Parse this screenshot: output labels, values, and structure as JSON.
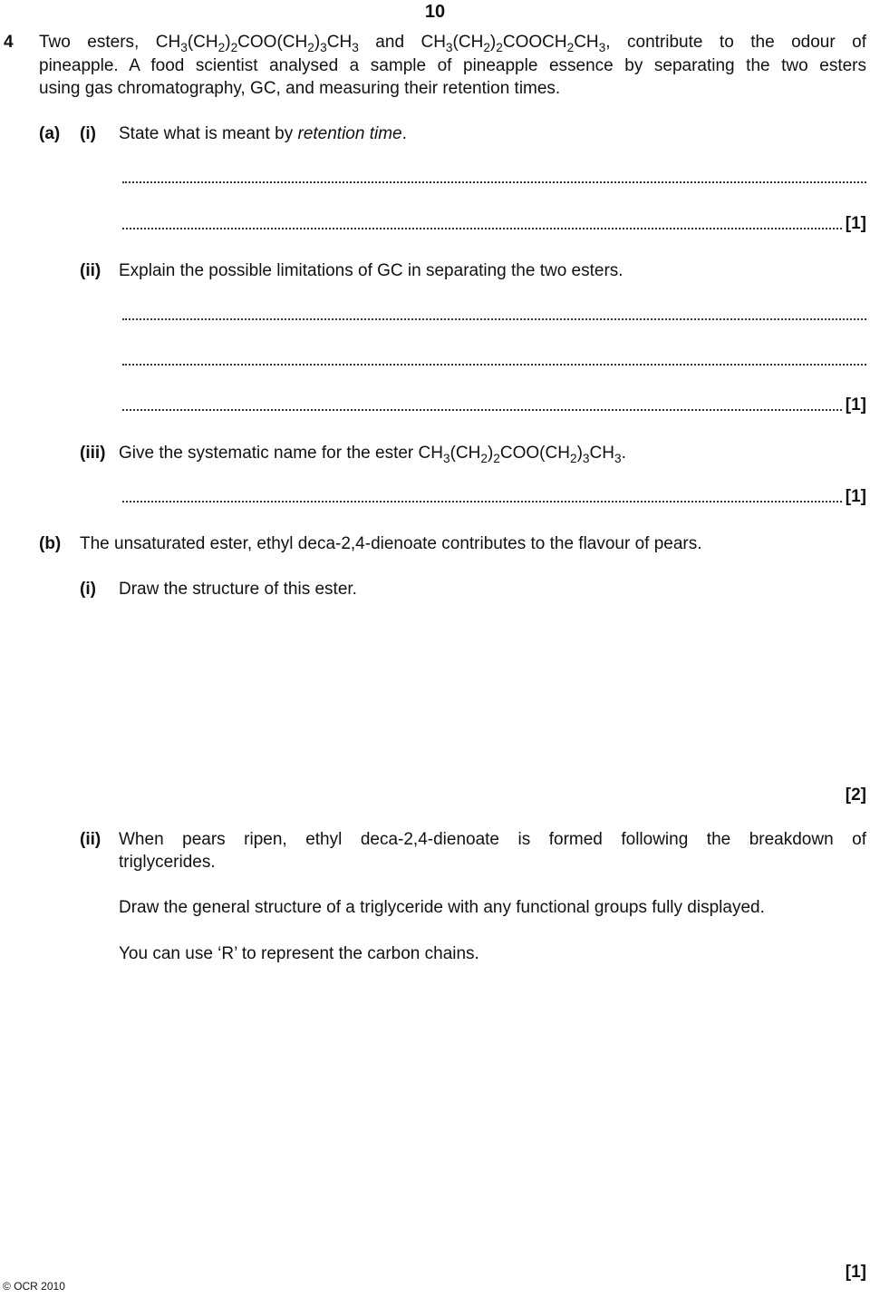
{
  "page_number": "10",
  "question": {
    "number": "4",
    "intro": {
      "line1": {
        "t1": "Two esters, CH",
        "s1": "3",
        "t2": "(CH",
        "s2": "2",
        "t3": ")",
        "s3": "2",
        "t4": "COO(CH",
        "s4": "2",
        "t5": ")",
        "s5": "3",
        "t6": "CH",
        "s6": "3",
        "t7": " and CH",
        "s7": "3",
        "t8": "(CH",
        "s8": "2",
        "t9": ")",
        "s9": "2",
        "t10": "COOCH",
        "s10": "2",
        "t11": "CH",
        "s11": "3",
        "t12": ", contribute to the odour of"
      },
      "line2": "pineapple. A food scientist analysed a sample of pineapple essence by separating the two esters",
      "line3": "using gas chromatography, GC, and measuring their retention times."
    },
    "part_a": {
      "label": "(a)",
      "i": {
        "label": "(i)",
        "text": "State what is meant by ",
        "italic": "retention time",
        "end": ".",
        "mark": "[1]"
      },
      "ii": {
        "label": "(ii)",
        "text": "Explain the possible limitations of GC in separating the two esters.",
        "mark": "[1]"
      },
      "iii": {
        "label": "(iii)",
        "t1": "Give the systematic name for the ester CH",
        "s1": "3",
        "t2": "(CH",
        "s2": "2",
        "t3": ")",
        "s3": "2",
        "t4": "COO(CH",
        "s4": "2",
        "t5": ")",
        "s5": "3",
        "t6": "CH",
        "s6": "3",
        "t7": ".",
        "mark": "[1]"
      }
    },
    "part_b": {
      "label": "(b)",
      "text": "The unsaturated ester, ethyl deca-2,4-dienoate contributes to the flavour of pears.",
      "i": {
        "label": "(i)",
        "text": "Draw the structure of this ester.",
        "mark": "[2]"
      },
      "ii": {
        "label": "(ii)",
        "line1": "When pears ripen, ethyl deca-2,4-dienoate is formed following the breakdown of",
        "line2": "triglycerides.",
        "instruction1": "Draw the general structure of a triglyceride with any functional groups fully displayed.",
        "instruction2": "You can use ‘R’ to represent the carbon chains.",
        "mark": "[1]"
      }
    }
  },
  "footer": "© OCR 2010"
}
